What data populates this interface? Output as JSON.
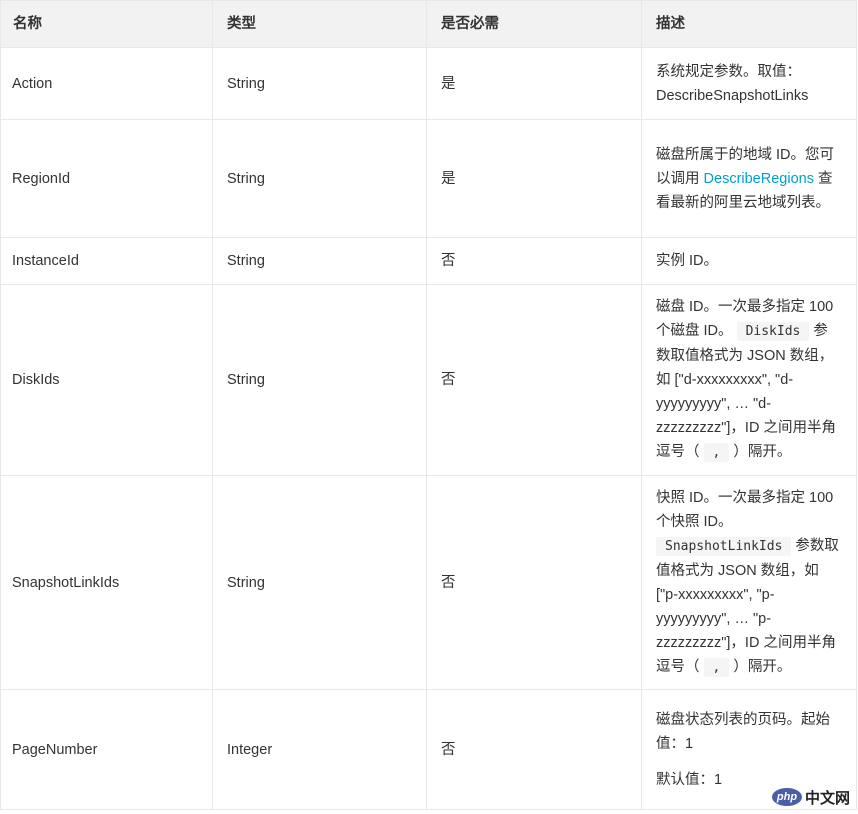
{
  "headers": [
    "名称",
    "类型",
    "是否必需",
    "描述"
  ],
  "rows": [
    {
      "name": "Action",
      "type": "String",
      "required": "是",
      "desc": [
        [
          {
            "t": "text",
            "v": "系统规定参数。取值：DescribeSnapshotLinks"
          }
        ]
      ]
    },
    {
      "name": "RegionId",
      "type": "String",
      "required": "是",
      "desc": [
        [
          {
            "t": "text",
            "v": "磁盘所属于的地域 ID。您可以调用 "
          },
          {
            "t": "link",
            "v": "DescribeRegions"
          },
          {
            "t": "text",
            "v": " 查看最新的阿里云地域列表。"
          }
        ]
      ]
    },
    {
      "name": "InstanceId",
      "type": "String",
      "required": "否",
      "desc": [
        [
          {
            "t": "text",
            "v": "实例 ID。"
          }
        ]
      ]
    },
    {
      "name": "DiskIds",
      "type": "String",
      "required": "否",
      "desc": [
        [
          {
            "t": "text",
            "v": "磁盘 ID。一次最多指定 100 个磁盘 ID。 "
          },
          {
            "t": "code",
            "v": "DiskIds"
          },
          {
            "t": "text",
            "v": " 参数取值格式为 JSON 数组，如 [\"d-xxxxxxxxx\", \"d-yyyyyyyyy\", … \"d-zzzzzzzzz\"]，ID 之间用半角逗号（ "
          },
          {
            "t": "code",
            "v": ","
          },
          {
            "t": "text",
            "v": " ）隔开。"
          }
        ]
      ]
    },
    {
      "name": "SnapshotLinkIds",
      "type": "String",
      "required": "否",
      "desc": [
        [
          {
            "t": "text",
            "v": "快照 ID。一次最多指定 100 个快照 ID。 "
          },
          {
            "t": "code",
            "v": "SnapshotLinkIds"
          },
          {
            "t": "text",
            "v": " 参数取值格式为 JSON 数组，如 [\"p-xxxxxxxxx\", \"p-yyyyyyyyy\", … \"p-zzzzzzzzz\"]，ID 之间用半角逗号（ "
          },
          {
            "t": "code",
            "v": ","
          },
          {
            "t": "text",
            "v": " ）隔开。"
          }
        ]
      ]
    },
    {
      "name": "PageNumber",
      "type": "Integer",
      "required": "否",
      "desc": [
        [
          {
            "t": "text",
            "v": "磁盘状态列表的页码。起始值：1"
          }
        ],
        [
          {
            "t": "text",
            "v": "默认值：1"
          }
        ]
      ]
    }
  ],
  "watermark": {
    "logo": "php",
    "text": "中文网"
  }
}
